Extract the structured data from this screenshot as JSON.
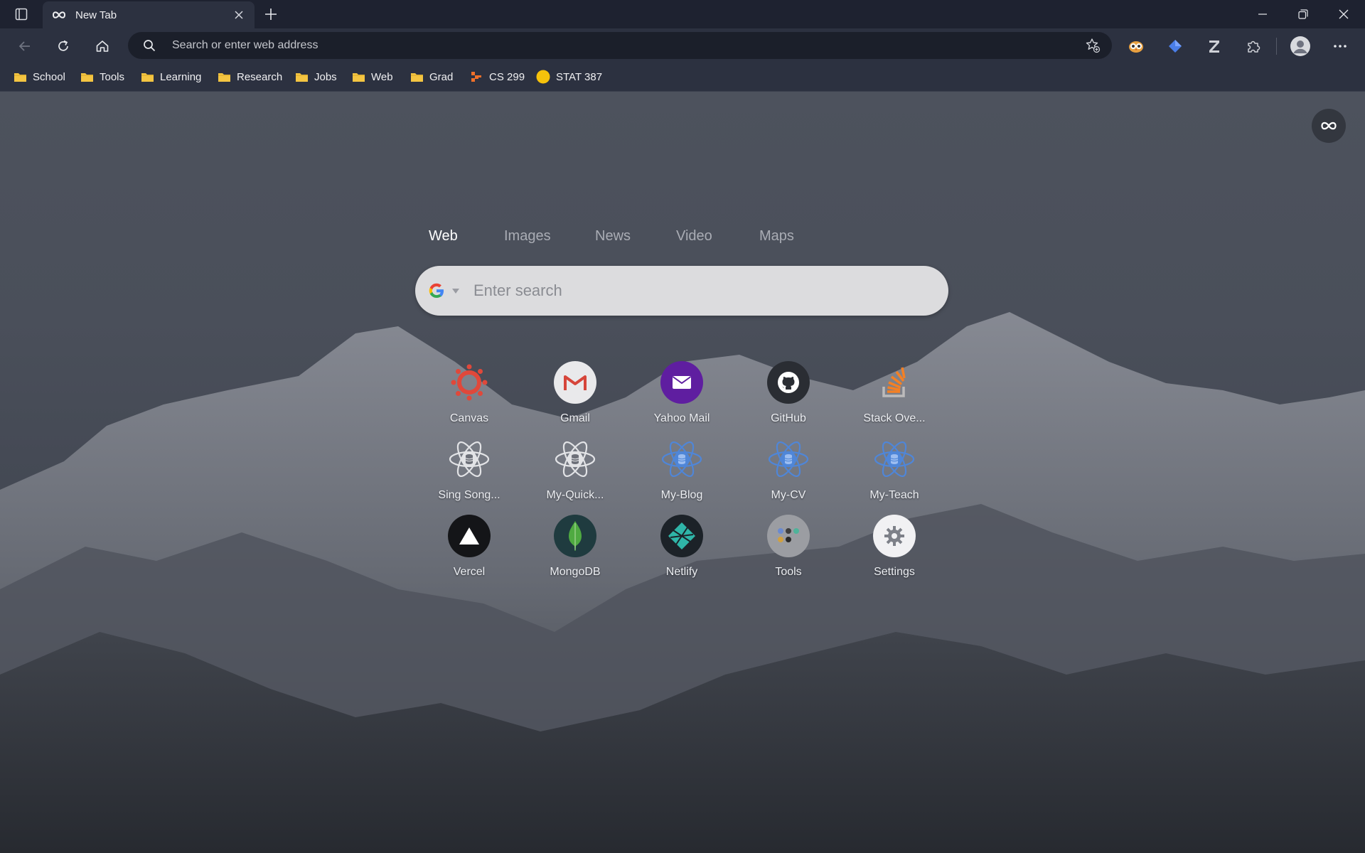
{
  "tab": {
    "title": "New Tab"
  },
  "omnibox": {
    "placeholder": "Search or enter web address"
  },
  "bookmarks": [
    {
      "label": "School",
      "icon": "folder-icon"
    },
    {
      "label": "Tools",
      "icon": "folder-icon"
    },
    {
      "label": "Learning",
      "icon": "folder-icon"
    },
    {
      "label": "Research",
      "icon": "folder-icon"
    },
    {
      "label": "Jobs",
      "icon": "folder-icon"
    },
    {
      "label": "Web",
      "icon": "folder-icon"
    },
    {
      "label": "Grad",
      "icon": "folder-icon"
    },
    {
      "label": "CS 299",
      "icon": "gitlab-style-icon"
    },
    {
      "label": "STAT 387",
      "icon": "yellow-circle-icon"
    }
  ],
  "search": {
    "tabs": [
      "Web",
      "Images",
      "News",
      "Video",
      "Maps"
    ],
    "active_tab": "Web",
    "placeholder": "Enter search",
    "engine": "Google"
  },
  "speed_dial": [
    {
      "label": "Canvas",
      "icon": "canvas-icon"
    },
    {
      "label": "Gmail",
      "icon": "gmail-icon"
    },
    {
      "label": "Yahoo Mail",
      "icon": "yahoo-mail-icon"
    },
    {
      "label": "GitHub",
      "icon": "github-icon"
    },
    {
      "label": "Stack Ove...",
      "icon": "stack-overflow-icon"
    },
    {
      "label": "Sing Song...",
      "icon": "database-globe-icon"
    },
    {
      "label": "My-Quick...",
      "icon": "database-globe-icon"
    },
    {
      "label": "My-Blog",
      "icon": "database-globe-icon"
    },
    {
      "label": "My-CV",
      "icon": "database-globe-icon"
    },
    {
      "label": "My-Teach",
      "icon": "database-globe-icon"
    },
    {
      "label": "Vercel",
      "icon": "vercel-icon"
    },
    {
      "label": "MongoDB",
      "icon": "mongodb-icon"
    },
    {
      "label": "Netlify",
      "icon": "netlify-icon"
    },
    {
      "label": "Tools",
      "icon": "tools-icon"
    },
    {
      "label": "Settings",
      "icon": "settings-icon"
    }
  ],
  "colors": {
    "tabstrip": "#1e2230",
    "toolbar": "#2c3140",
    "folder": "#f4c542",
    "canvas": "#e0483a",
    "yahoo": "#5f1ea0",
    "stackoverflow": "#f48024",
    "mongodb": "#4faa41",
    "netlify": "#2fb5a8"
  }
}
